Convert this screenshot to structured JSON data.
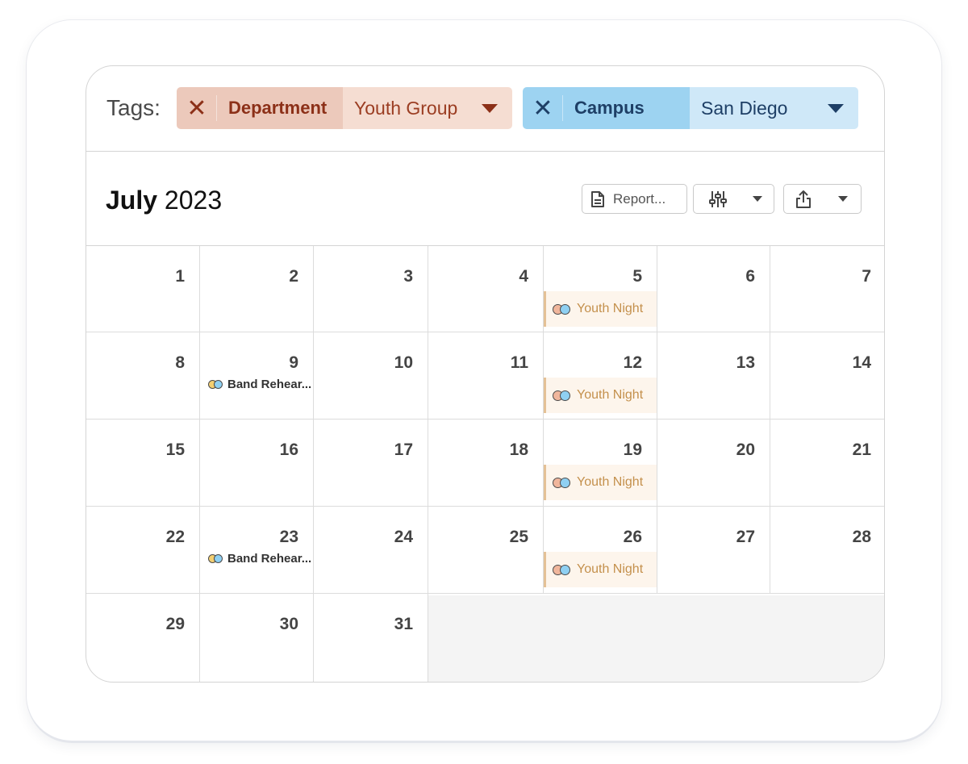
{
  "tags": {
    "label": "Tags:",
    "filters": [
      {
        "key": "Department",
        "value": "Youth Group",
        "color": "#ecc9bb"
      },
      {
        "key": "Campus",
        "value": "San Diego",
        "color": "#9dd3f1"
      }
    ]
  },
  "header": {
    "month": "July",
    "year": "2023",
    "report_label": "Report..."
  },
  "days": [
    {
      "num": "1"
    },
    {
      "num": "2"
    },
    {
      "num": "3"
    },
    {
      "num": "4"
    },
    {
      "num": "5",
      "event": "Youth Night",
      "type": "youth"
    },
    {
      "num": "6"
    },
    {
      "num": "7"
    },
    {
      "num": "8"
    },
    {
      "num": "9",
      "event": "Band Rehear...",
      "type": "band"
    },
    {
      "num": "10"
    },
    {
      "num": "11"
    },
    {
      "num": "12",
      "event": "Youth Night",
      "type": "youth"
    },
    {
      "num": "13"
    },
    {
      "num": "14"
    },
    {
      "num": "15"
    },
    {
      "num": "16"
    },
    {
      "num": "17"
    },
    {
      "num": "18"
    },
    {
      "num": "19",
      "event": "Youth Night",
      "type": "youth"
    },
    {
      "num": "20"
    },
    {
      "num": "21"
    },
    {
      "num": "22"
    },
    {
      "num": "23",
      "event": "Band Rehear...",
      "type": "band"
    },
    {
      "num": "24"
    },
    {
      "num": "25"
    },
    {
      "num": "26",
      "event": "Youth Night",
      "type": "youth"
    },
    {
      "num": "27"
    },
    {
      "num": "28"
    },
    {
      "num": "29"
    },
    {
      "num": "30"
    },
    {
      "num": "31"
    }
  ],
  "icons": {
    "remove": "close-icon",
    "dropdown": "caret-down-icon",
    "report": "document-icon",
    "filter": "sliders-icon",
    "share": "share-icon",
    "event_tags": "tag-dots-icon"
  }
}
